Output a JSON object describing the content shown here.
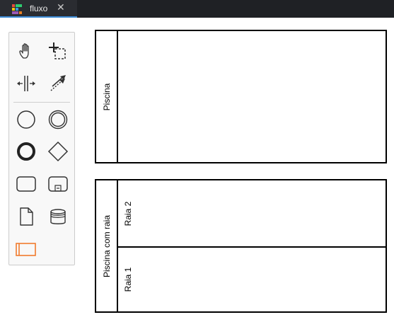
{
  "tab": {
    "title": "fluxo",
    "close_glyph": "✕",
    "icon": "diagram-logo-icon"
  },
  "palette": {
    "tools": [
      {
        "name": "hand-tool",
        "icon": "hand-icon"
      },
      {
        "name": "lasso-tool",
        "icon": "lasso-select-icon"
      },
      {
        "name": "space-tool",
        "icon": "space-tool-icon"
      },
      {
        "name": "connect-tool",
        "icon": "connect-arrow-icon"
      },
      {
        "name": "start-event",
        "icon": "start-event-icon"
      },
      {
        "name": "intermediate-event",
        "icon": "intermediate-event-icon"
      },
      {
        "name": "end-event",
        "icon": "end-event-icon"
      },
      {
        "name": "gateway",
        "icon": "gateway-icon"
      },
      {
        "name": "task",
        "icon": "task-icon"
      },
      {
        "name": "subprocess",
        "icon": "subprocess-icon"
      },
      {
        "name": "data-object",
        "icon": "data-object-icon"
      },
      {
        "name": "data-store",
        "icon": "data-store-icon"
      },
      {
        "name": "participant",
        "icon": "participant-icon"
      }
    ],
    "accent_color": "#f07b2e"
  },
  "canvas": {
    "pool1": {
      "label": "Piscina"
    },
    "pool2": {
      "label": "Piscina com raia",
      "lanes": [
        {
          "label": "Raia 2"
        },
        {
          "label": "Raia 1"
        }
      ]
    }
  }
}
